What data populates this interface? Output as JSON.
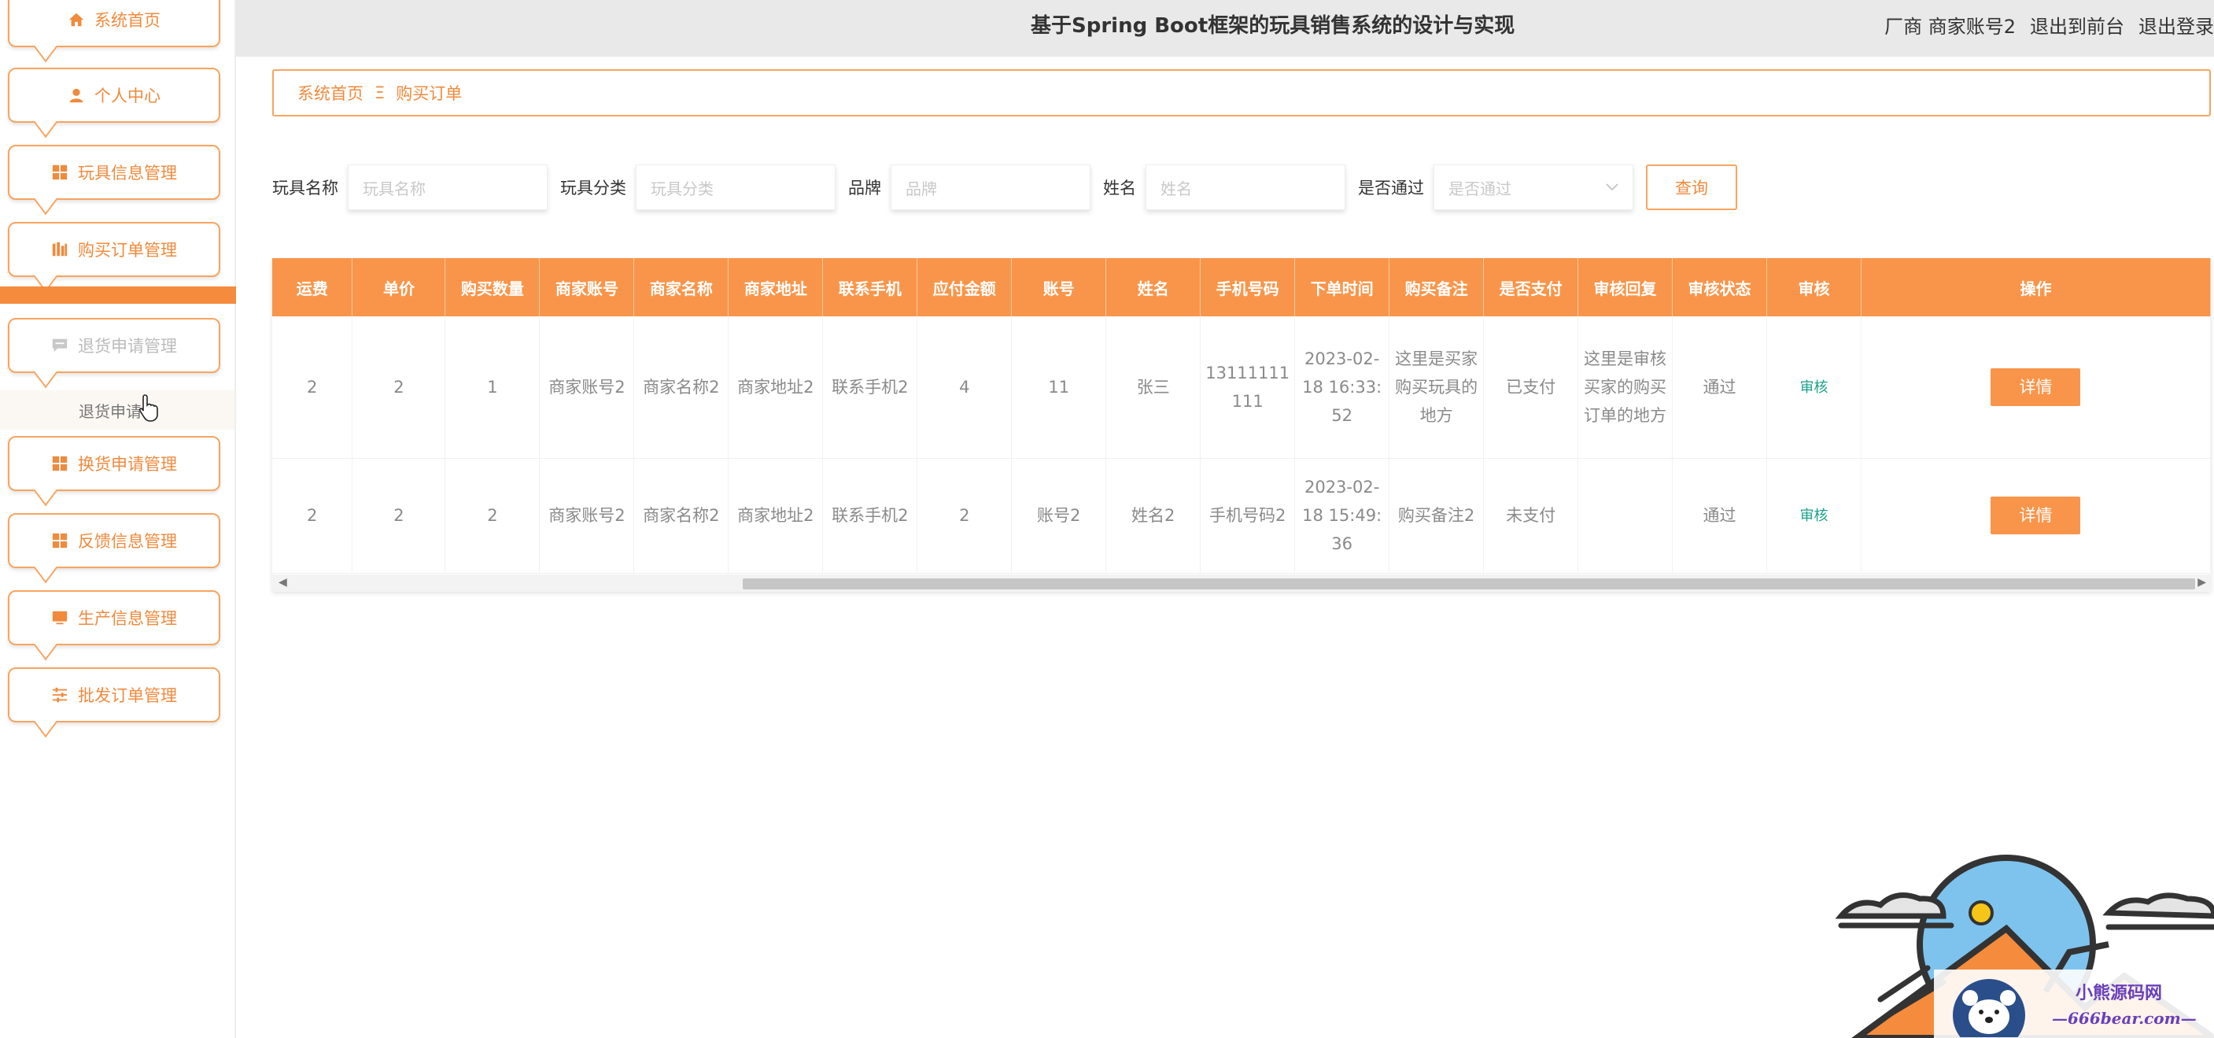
{
  "header": {
    "title": "基于Spring Boot框架的玩具销售系统的设计与实现",
    "user": "厂商 商家账号2",
    "back_frontend": "退出到前台",
    "logout": "退出登录"
  },
  "sidebar": {
    "items": [
      {
        "label": "系统首页",
        "icon": "home-icon"
      },
      {
        "label": "个人中心",
        "icon": "user-icon"
      },
      {
        "label": "玩具信息管理",
        "icon": "grid-icon"
      },
      {
        "label": "购买订单管理",
        "icon": "bars-icon"
      },
      {
        "label": "退货申请管理",
        "icon": "message-icon"
      },
      {
        "label": "换货申请管理",
        "icon": "grid-icon"
      },
      {
        "label": "反馈信息管理",
        "icon": "grid-icon"
      },
      {
        "label": "生产信息管理",
        "icon": "monitor-icon"
      },
      {
        "label": "批发订单管理",
        "icon": "sliders-icon"
      }
    ],
    "submenu_label": "退货申请"
  },
  "breadcrumb": {
    "home": "系统首页",
    "separator": "Ξ",
    "current": "购买订单"
  },
  "search": {
    "toy_name_label": "玩具名称",
    "toy_name_placeholder": "玩具名称",
    "category_label": "玩具分类",
    "category_placeholder": "玩具分类",
    "brand_label": "品牌",
    "brand_placeholder": "品牌",
    "name_label": "姓名",
    "name_placeholder": "姓名",
    "pass_label": "是否通过",
    "pass_placeholder": "是否通过",
    "query_button": "查询"
  },
  "table": {
    "columns": [
      "运费",
      "单价",
      "购买数量",
      "商家账号",
      "商家名称",
      "商家地址",
      "联系手机",
      "应付金额",
      "账号",
      "姓名",
      "手机号码",
      "下单时间",
      "购买备注",
      "是否支付",
      "审核回复",
      "审核状态",
      "审核",
      "操作"
    ],
    "rows": [
      {
        "freight": "2",
        "price": "2",
        "qty": "1",
        "merchant_account": "商家账号2",
        "merchant_name": "商家名称2",
        "merchant_address": "商家地址2",
        "contact_phone": "联系手机2",
        "amount": "4",
        "account": "11",
        "name": "张三",
        "phone": "13111111111",
        "order_time": "2023-02-18 16:33:52",
        "remark": "这里是买家购买玩具的地方",
        "paid": "已支付",
        "reply": "这里是审核买家的购买订单的地方",
        "status": "通过",
        "audit": "审核",
        "action": "详情"
      },
      {
        "freight": "2",
        "price": "2",
        "qty": "2",
        "merchant_account": "商家账号2",
        "merchant_name": "商家名称2",
        "merchant_address": "商家地址2",
        "contact_phone": "联系手机2",
        "amount": "2",
        "account": "账号2",
        "name": "姓名2",
        "phone": "手机号码2",
        "order_time": "2023-02-18 15:49:36",
        "remark": "购买备注2",
        "paid": "未支付",
        "reply": "",
        "status": "通过",
        "audit": "审核",
        "action": "详情"
      }
    ]
  },
  "watermark": {
    "brand": "小熊源码网",
    "url": "—666bear.com—"
  },
  "colors": {
    "accent": "#f9954a",
    "accent_border": "#f8a460",
    "audit_link": "#1aa28b"
  }
}
